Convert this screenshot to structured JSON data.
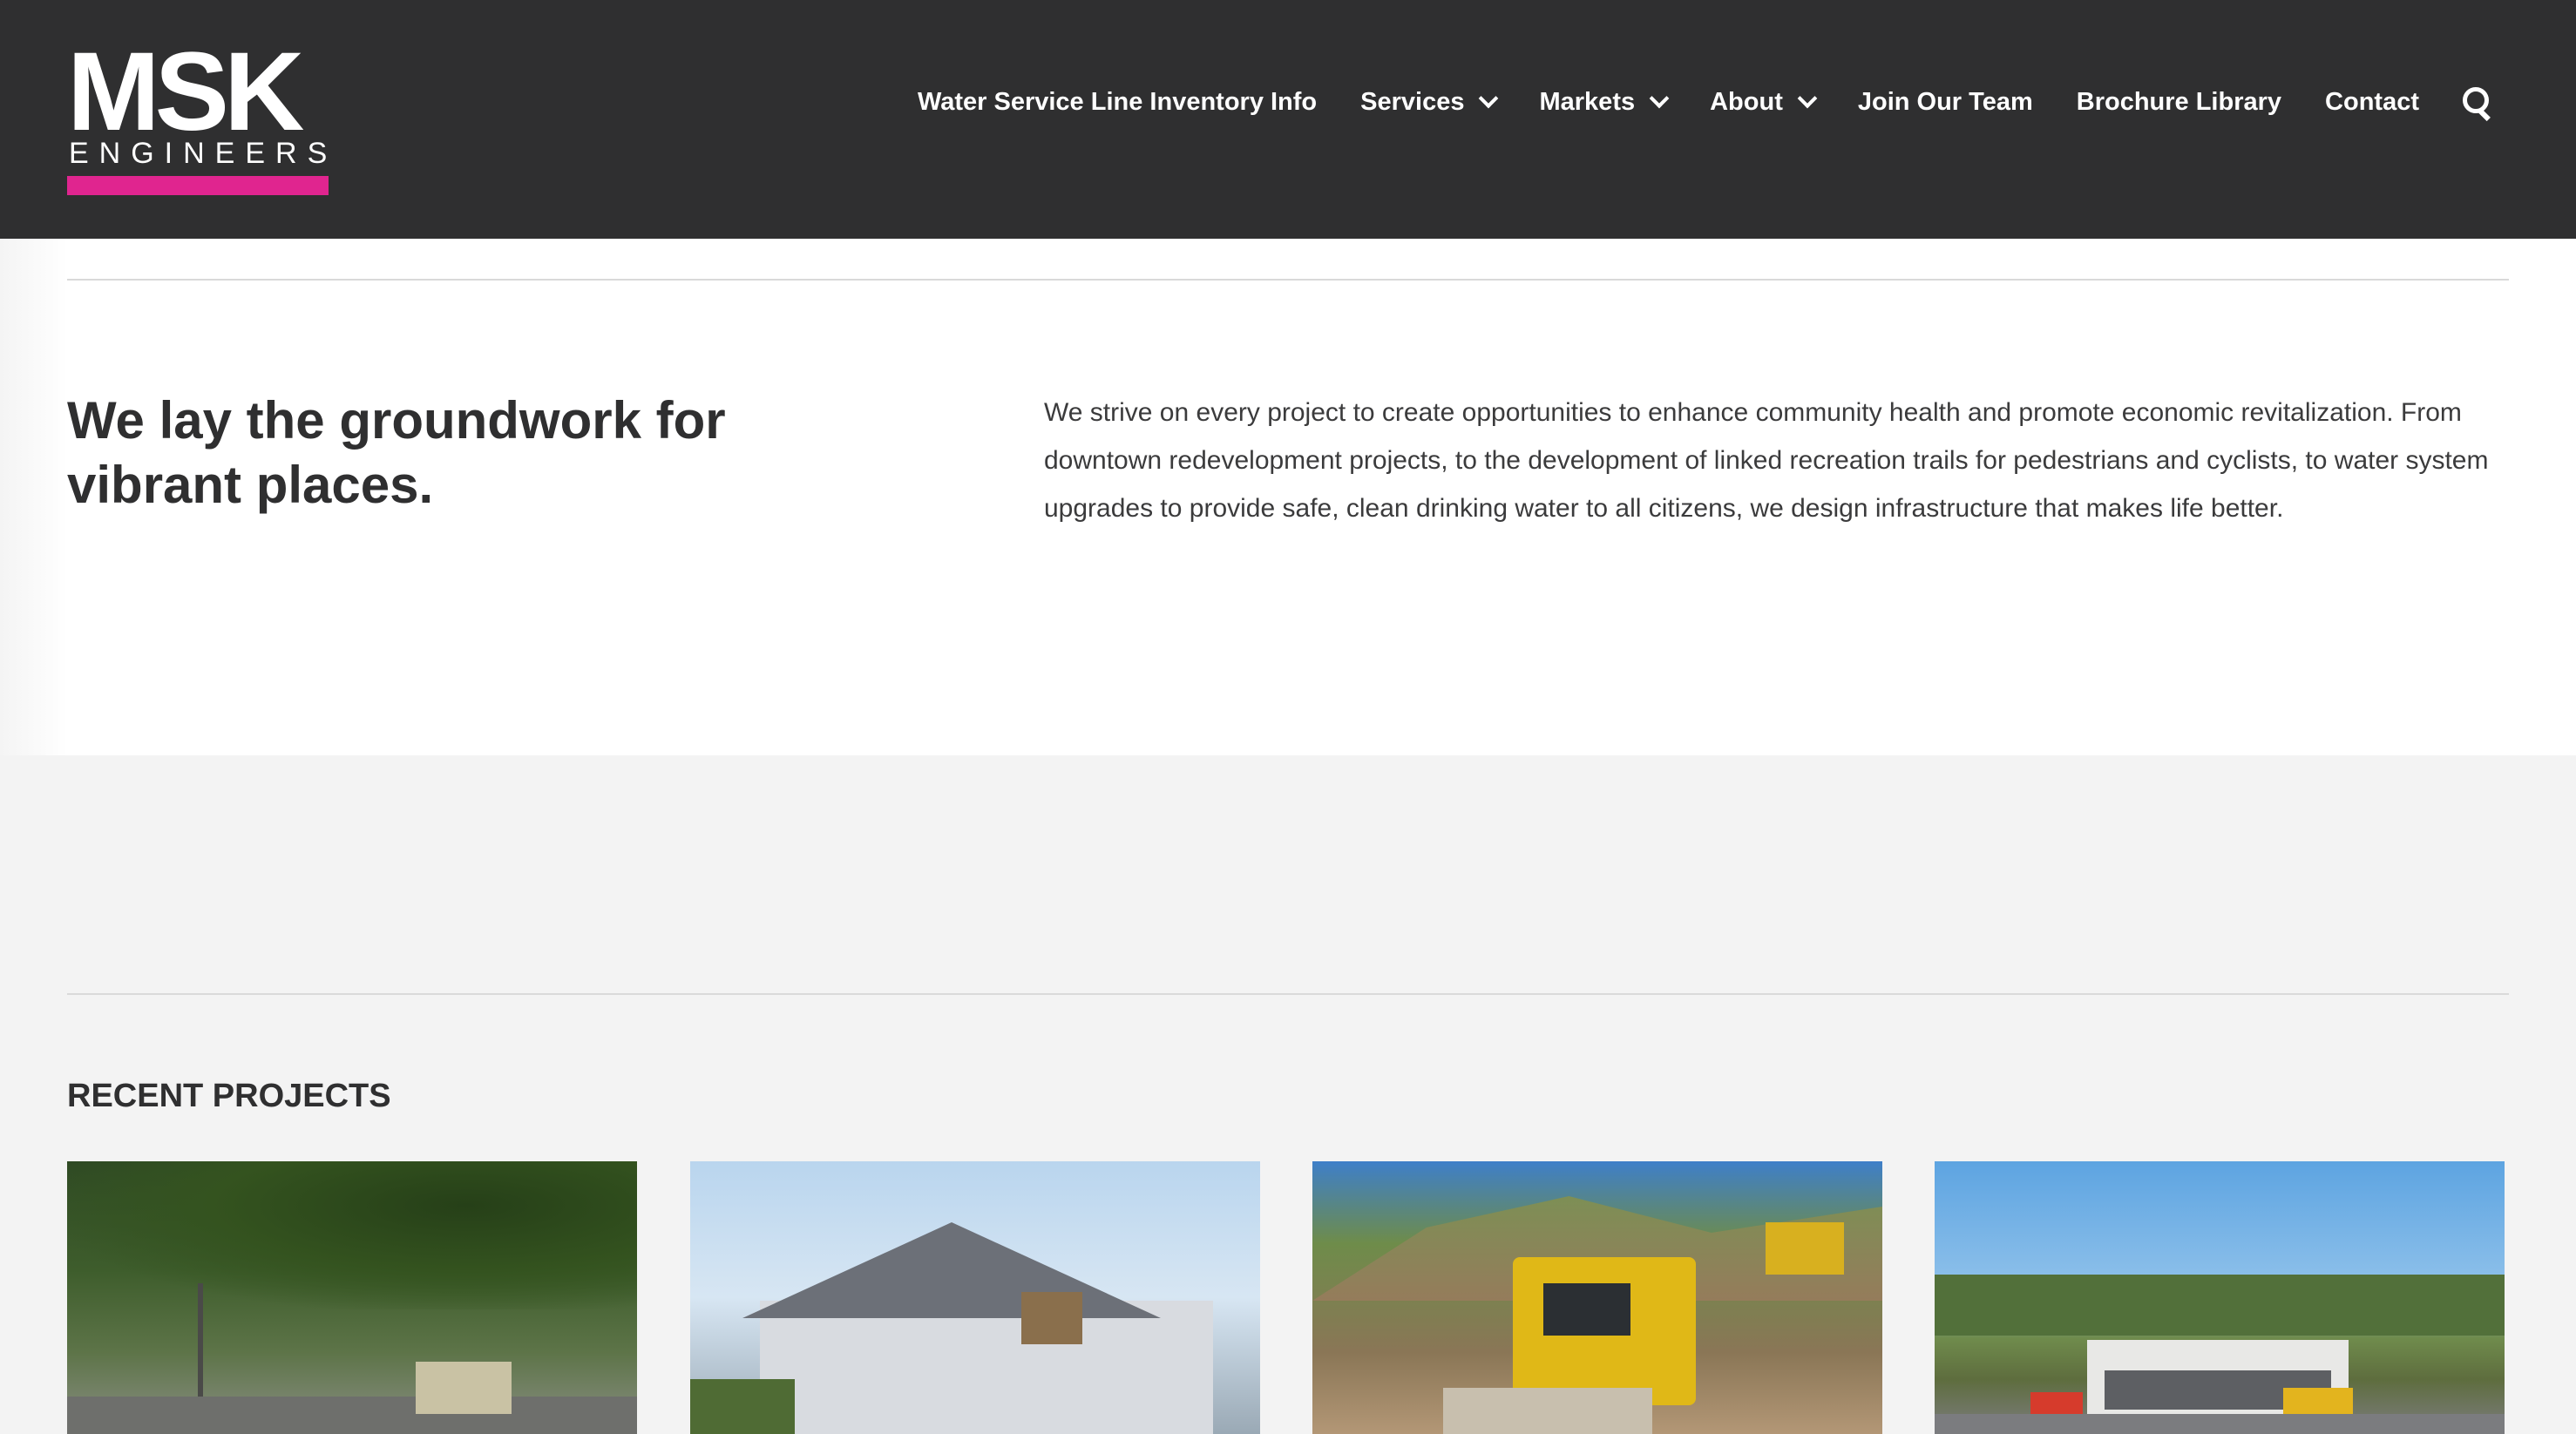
{
  "header": {
    "logo": {
      "main": "MSK",
      "sub": "ENGINEERS"
    },
    "nav": [
      {
        "label": "Water Service Line Inventory Info",
        "dropdown": false
      },
      {
        "label": "Services",
        "dropdown": true
      },
      {
        "label": "Markets",
        "dropdown": true
      },
      {
        "label": "About",
        "dropdown": true
      },
      {
        "label": "Join Our Team",
        "dropdown": false
      },
      {
        "label": "Brochure Library",
        "dropdown": false
      },
      {
        "label": "Contact",
        "dropdown": false
      }
    ],
    "search_icon": "search-icon"
  },
  "intro": {
    "headline": "We lay the groundwork for vibrant places.",
    "body": "We strive on every project to create opportunities to enhance community health and promote economic revitalization. From downtown redevelopment projects, to the development of linked recreation trails for pedestrians and cyclists, to water system upgrades to provide safe, clean drinking water to all citizens, we design infrastructure that makes life better."
  },
  "projects": {
    "title": "RECENT PROJECTS"
  },
  "colors": {
    "header_bg": "#2f2f30",
    "accent": "#e0258f",
    "page_bg": "#f3f3f3"
  }
}
